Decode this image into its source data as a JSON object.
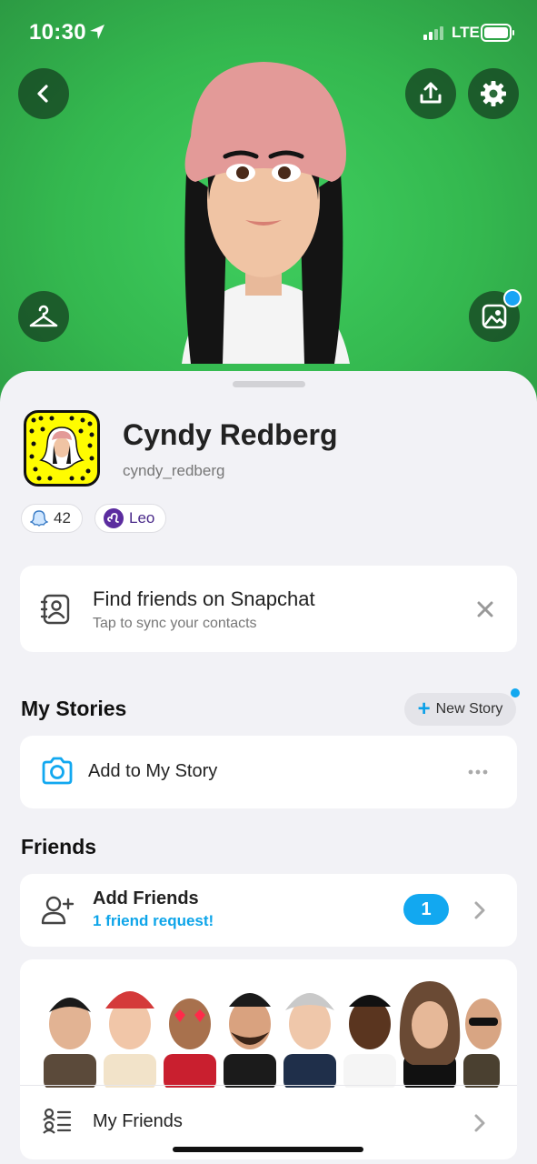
{
  "status_bar": {
    "time": "10:30",
    "network": "LTE"
  },
  "profile": {
    "display_name": "Cyndy Redberg",
    "username": "cyndy_redberg",
    "snapscore": "42",
    "zodiac": "Leo"
  },
  "find_friends": {
    "title": "Find friends on Snapchat",
    "subtitle": "Tap to sync your contacts"
  },
  "my_stories": {
    "title": "My Stories",
    "new_story_label": "New Story",
    "add_story_label": "Add to My Story"
  },
  "friends": {
    "title": "Friends",
    "add_friends_label": "Add Friends",
    "friend_request_text": "1 friend request!",
    "request_count": "1",
    "my_friends_label": "My Friends"
  },
  "colors": {
    "hero_green": "#34b84f",
    "snap_yellow": "#fffc00",
    "accent_blue": "#12a8f0",
    "leo_purple": "#5b2c9f"
  },
  "icons": [
    "back-icon",
    "share-icon",
    "gear-icon",
    "hanger-icon",
    "photo-icon",
    "contacts-icon",
    "close-icon",
    "camera-icon",
    "more-icon",
    "add-friend-icon",
    "chevron-right-icon",
    "friends-list-icon"
  ]
}
